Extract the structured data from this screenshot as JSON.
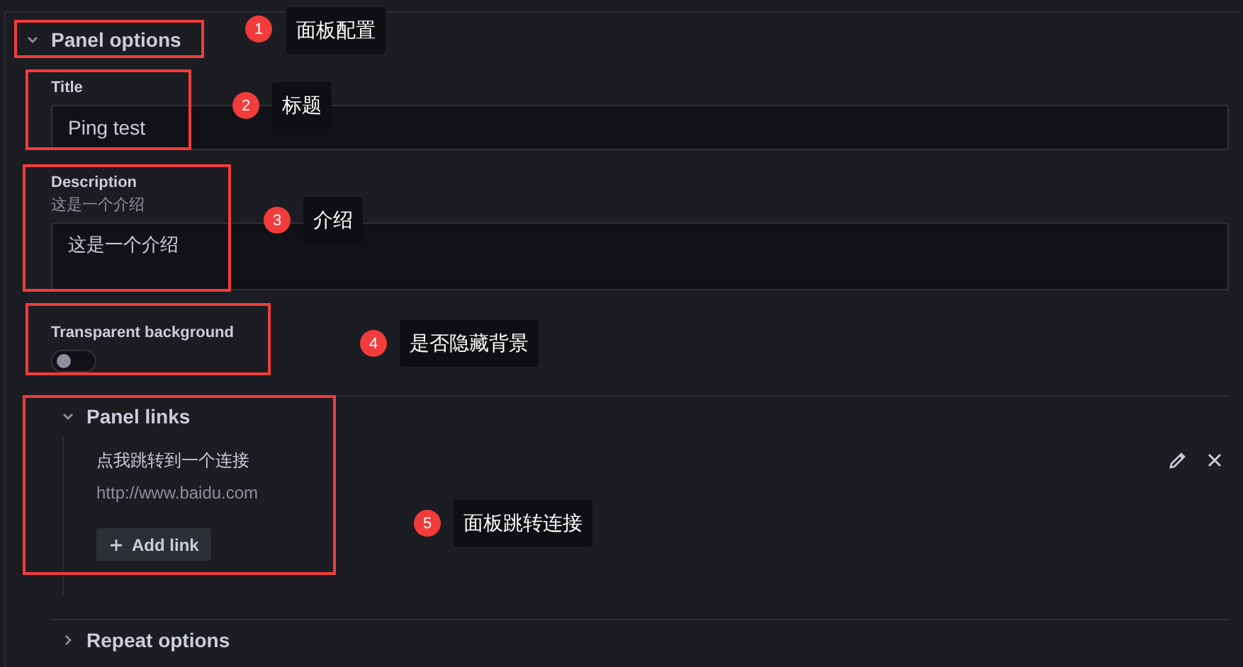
{
  "sections": [
    {
      "title": "Panel options",
      "expanded": true,
      "fields": [
        {
          "kind": "input",
          "label": "Title",
          "value": "Ping test"
        },
        {
          "kind": "textarea",
          "label": "Description",
          "description": "这是一个介绍",
          "value": "这是一个介绍"
        },
        {
          "kind": "switch",
          "label": "Transparent background",
          "on": false
        }
      ]
    },
    {
      "title": "Panel links",
      "expanded": true,
      "links": [
        {
          "title": "点我跳转到一个连接",
          "url": "http://www.baidu.com"
        }
      ],
      "add_button": "Add link"
    },
    {
      "title": "Repeat options",
      "expanded": false
    }
  ],
  "annotations": [
    {
      "number": "1",
      "text": "面板配置"
    },
    {
      "number": "2",
      "text": "标题"
    },
    {
      "number": "3",
      "text": "介绍"
    },
    {
      "number": "4",
      "text": "是否隐藏背景"
    },
    {
      "number": "5",
      "text": "面板跳转连接"
    }
  ]
}
